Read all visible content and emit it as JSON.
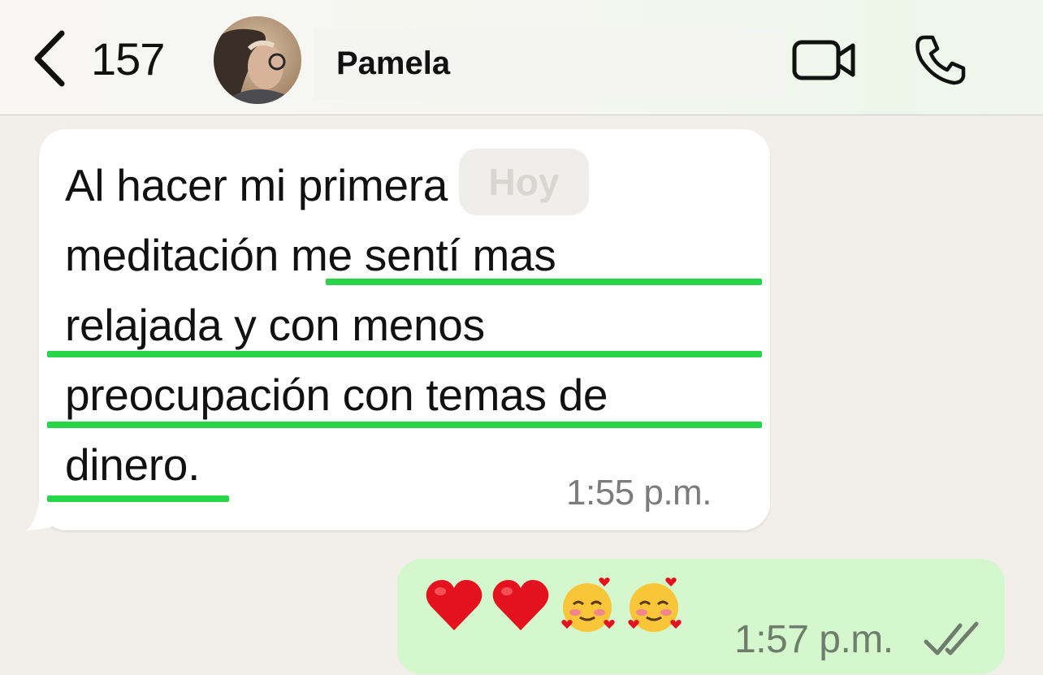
{
  "header": {
    "back_count": "157",
    "contact_name": "Pamela",
    "avatar_icon": "contact-avatar",
    "video_icon": "video-camera-icon",
    "call_icon": "phone-icon"
  },
  "chat": {
    "date_label": "Hoy",
    "incoming": {
      "lines": [
        "Al hacer mi primera",
        "meditación me sentí mas",
        "relajada y con menos",
        "preocupación con temas de",
        "dinero."
      ],
      "time": "1:55 p.m.",
      "highlight_color": "#27d44a"
    },
    "outgoing": {
      "emojis": [
        "red-heart",
        "red-heart",
        "smiling-face-with-hearts",
        "smiling-face-with-hearts"
      ],
      "time": "1:57 p.m.",
      "status": "read-double-check"
    }
  },
  "colors": {
    "chat_background": "#f2efea",
    "incoming_bubble": "#ffffff",
    "outgoing_bubble": "#d4f7cd"
  }
}
